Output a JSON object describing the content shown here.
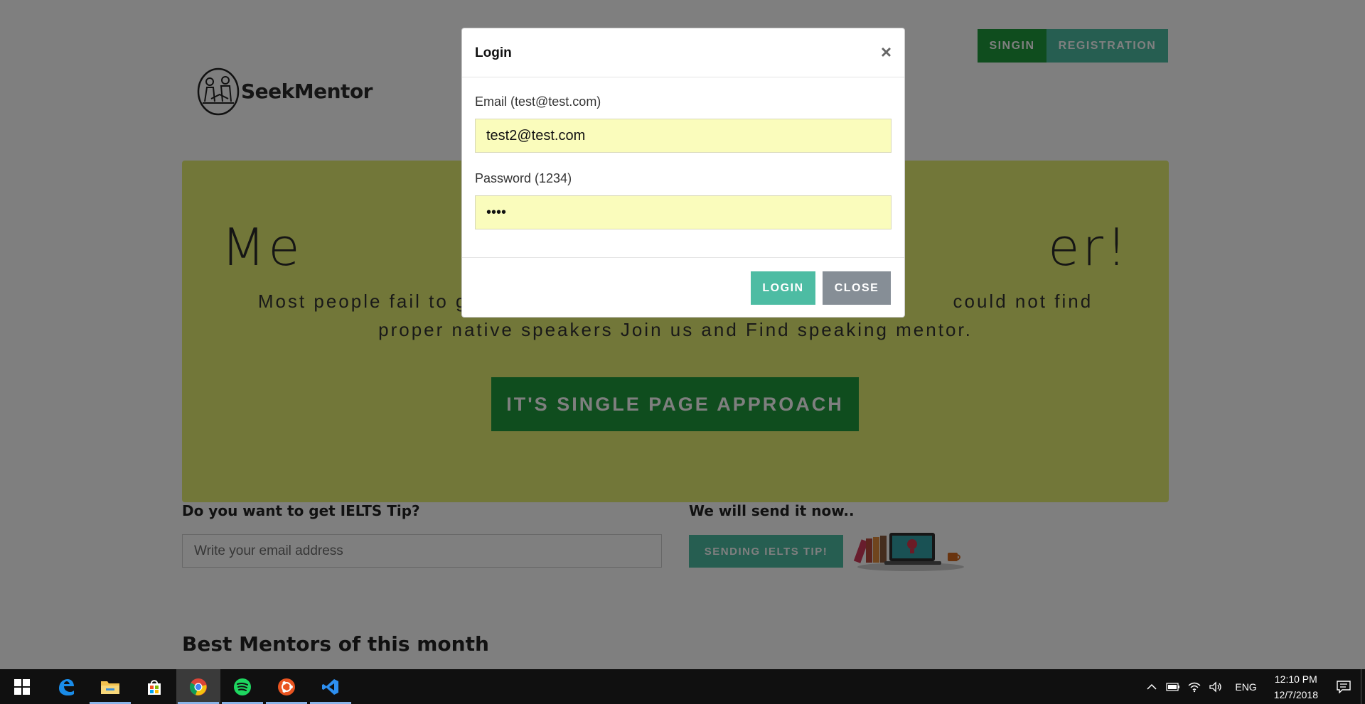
{
  "site": {
    "logo_text": "SeekMentor",
    "nav": {
      "signin": "SINGIN",
      "registration": "REGISTRATION"
    }
  },
  "hero": {
    "title": "Me                                       er!",
    "text": "Most people fail to get                                                                could not find proper native speakers Join us and Find speaking mentor.",
    "button": "IT'S SINGLE PAGE APPROACH"
  },
  "tip": {
    "left_label": "Do you want to get IELTS Tip?",
    "input_placeholder": "Write your email address",
    "right_label": "We will send it now..",
    "button": "SENDING IELTS TIP!"
  },
  "mentors": {
    "title": "Best Mentors of this month"
  },
  "modal": {
    "title": "Login",
    "close_symbol": "×",
    "email_label": "Email (test@test.com)",
    "email_value": "test2@test.com",
    "password_label": "Password (1234)",
    "password_value": "1234",
    "login_button": "LOGIN",
    "close_button": "CLOSE"
  },
  "taskbar": {
    "apps": [
      "windows-start",
      "edge",
      "file-explorer",
      "store",
      "chrome",
      "spotify",
      "ubuntu",
      "vscode"
    ],
    "language": "ENG",
    "time": "12:10 PM",
    "date": "12/7/2018"
  },
  "colors": {
    "green": "#1f9b3d",
    "teal": "#4dbca3",
    "hero_yellow": "#e5ee73",
    "input_yellow": "#fafcbc",
    "grey_button": "#868e96"
  }
}
